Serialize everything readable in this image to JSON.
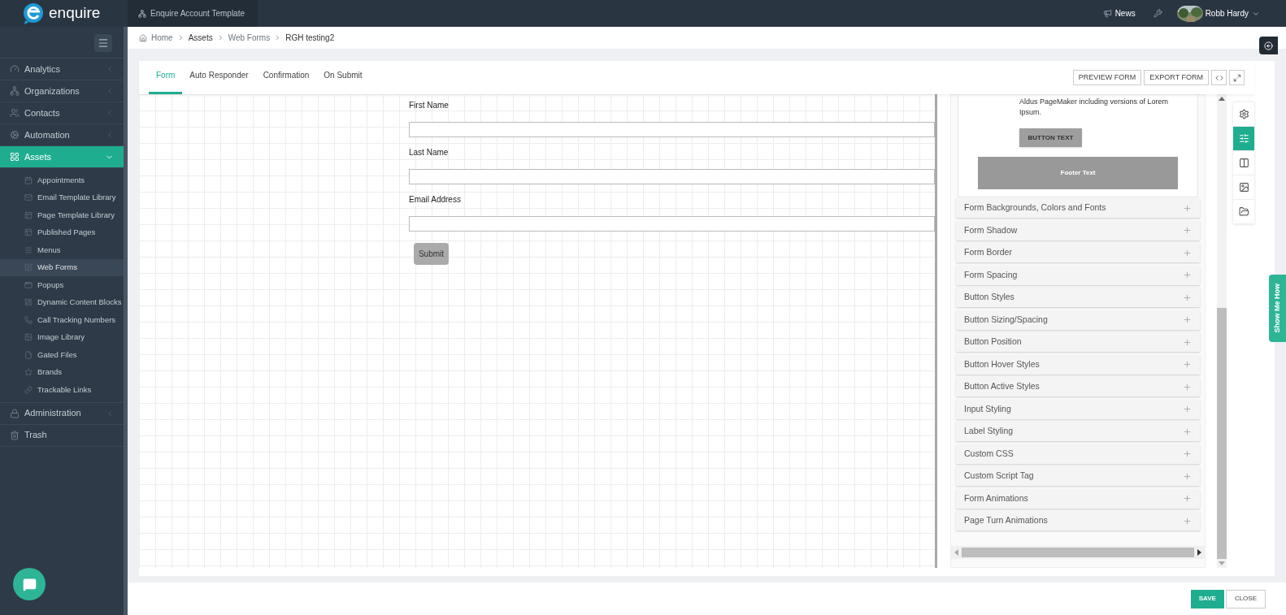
{
  "header": {
    "brand": "enquire",
    "account": "Enquire Account Template",
    "news": "News",
    "user": "Robb Hardy"
  },
  "breadcrumb": [
    "Home",
    "Assets",
    "Web Forms",
    "RGH testing2"
  ],
  "sidebar": {
    "items": [
      {
        "label": "Analytics",
        "expanded": false,
        "selected": false
      },
      {
        "label": "Organizations",
        "expanded": false,
        "selected": false
      },
      {
        "label": "Contacts",
        "expanded": false,
        "selected": false
      },
      {
        "label": "Automation",
        "expanded": false,
        "selected": false
      },
      {
        "label": "Assets",
        "expanded": true,
        "selected": true,
        "children": [
          {
            "label": "Appointments",
            "selected": false
          },
          {
            "label": "Email Template Library",
            "selected": false
          },
          {
            "label": "Page Template Library",
            "selected": false
          },
          {
            "label": "Published Pages",
            "selected": false
          },
          {
            "label": "Menus",
            "selected": false
          },
          {
            "label": "Web Forms",
            "selected": true
          },
          {
            "label": "Popups",
            "selected": false
          },
          {
            "label": "Dynamic Content Blocks",
            "selected": false
          },
          {
            "label": "Call Tracking Numbers",
            "selected": false
          },
          {
            "label": "Image Library",
            "selected": false
          },
          {
            "label": "Gated Files",
            "selected": false
          },
          {
            "label": "Brands",
            "selected": false
          },
          {
            "label": "Trackable Links",
            "selected": false
          }
        ]
      },
      {
        "label": "Administration",
        "expanded": false,
        "selected": false
      },
      {
        "label": "Trash",
        "selected": false
      }
    ]
  },
  "tabs": [
    {
      "label": "Form",
      "selected": true
    },
    {
      "label": "Auto Responder",
      "selected": false
    },
    {
      "label": "Confirmation",
      "selected": false
    },
    {
      "label": "On Submit",
      "selected": false
    }
  ],
  "toolbar": {
    "preview": "PREVIEW FORM",
    "export": "EXPORT FORM"
  },
  "form": {
    "fields": [
      {
        "label": "First Name"
      },
      {
        "label": "Last Name"
      },
      {
        "label": "Email Address"
      }
    ],
    "submit": "Submit"
  },
  "preview": {
    "text": "Aldus PageMaker including versions of Lorem Ipsum.",
    "button": "BUTTON TEXT",
    "footer": "Footer Text"
  },
  "sections": [
    {
      "label": "Form Backgrounds, Colors and Fonts",
      "expanded": false
    },
    {
      "label": "Form Shadow",
      "expanded": false
    },
    {
      "label": "Form Border",
      "expanded": false
    },
    {
      "label": "Form Spacing",
      "expanded": false
    },
    {
      "label": "Button Styles",
      "expanded": false
    },
    {
      "label": "Button Sizing/Spacing",
      "expanded": false
    },
    {
      "label": "Button Position",
      "expanded": false
    },
    {
      "label": "Button Hover Styles",
      "expanded": false
    },
    {
      "label": "Button Active Styles",
      "expanded": false
    },
    {
      "label": "Input Styling",
      "expanded": false
    },
    {
      "label": "Label Styling",
      "expanded": false
    },
    {
      "label": "Custom CSS",
      "expanded": false
    },
    {
      "label": "Custom Script Tag",
      "expanded": false
    },
    {
      "label": "Form Animations",
      "expanded": false
    },
    {
      "label": "Page Turn Animations",
      "expanded": false
    }
  ],
  "tools": [
    {
      "selected": false
    },
    {
      "selected": true
    },
    {
      "selected": false
    },
    {
      "selected": false
    },
    {
      "selected": false
    }
  ],
  "help_tab": "Show Me How",
  "footer": {
    "save": "SAVE",
    "close": "CLOSE"
  }
}
